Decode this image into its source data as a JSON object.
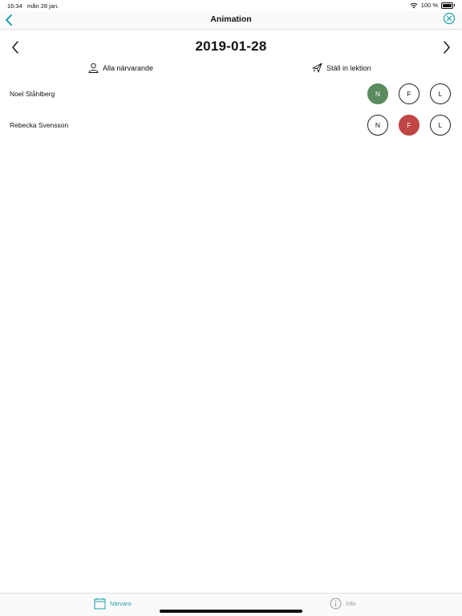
{
  "status": {
    "time": "16:34",
    "date": "mån 28 jan.",
    "battery": "100 %"
  },
  "nav": {
    "title": "Animation"
  },
  "date_nav": {
    "date": "2019-01-28"
  },
  "actions": {
    "all_present": "Alla närvarande",
    "cancel_lesson": "Ställ in lektion"
  },
  "students": [
    {
      "name": "Noel Ståhlberg",
      "selected": "N",
      "options": [
        "N",
        "F",
        "L"
      ]
    },
    {
      "name": "Rebecka Svensson",
      "selected": "F",
      "options": [
        "N",
        "F",
        "L"
      ]
    }
  ],
  "tabs": [
    {
      "label": "Närvaro",
      "icon": "calendar-icon",
      "active": true
    },
    {
      "label": "Info",
      "icon": "info-icon",
      "active": false
    }
  ],
  "colors": {
    "accent": "#1f9fae",
    "present": "#5a8c5e",
    "absent": "#c04545"
  }
}
